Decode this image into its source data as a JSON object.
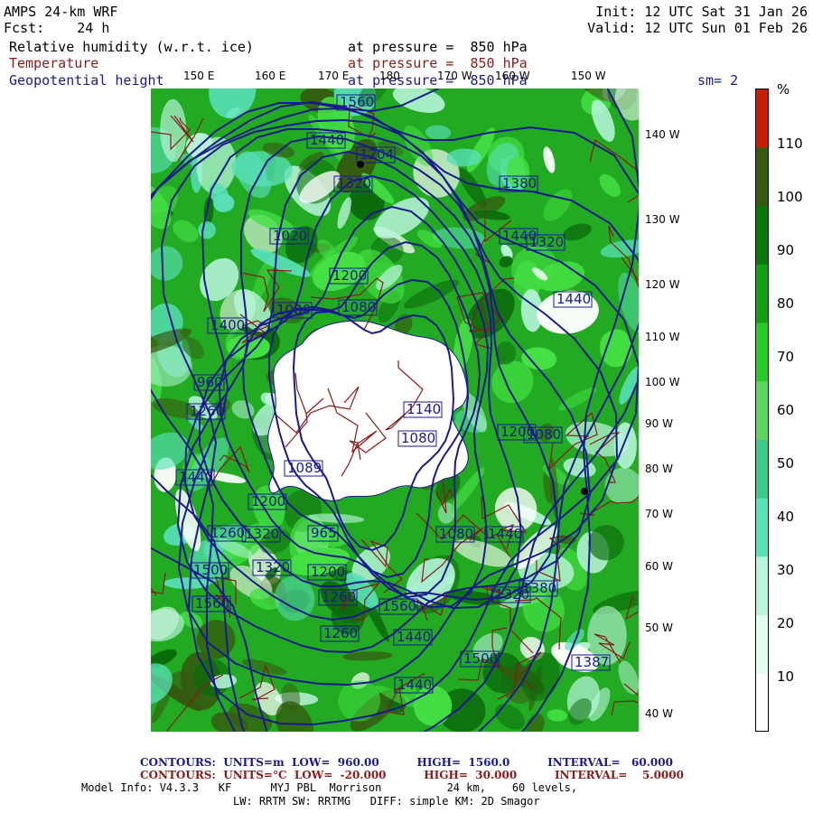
{
  "header": {
    "left_line1": "AMPS 24-km WRF",
    "left_line2": "Fcst:    24 h",
    "right_line1": "Init: 12 UTC Sat 31 Jan 26",
    "right_line2": "Valid: 12 UTC Sun 01 Feb 26",
    "field1_name": "Relative humidity (w.r.t. ice)",
    "field1_level": "at pressure =  850 hPa",
    "field2_name": "Temperature",
    "field2_level": "at pressure =  850 hPa",
    "field3_name": "Geopotential height",
    "field3_level": "at pressure =  850 hPa",
    "smoothing": "sm= 2"
  },
  "colors": {
    "rh_fill_main": "#22aa22",
    "rh_fill_light": "#44e044",
    "rh_fill_dark": "#0b6b0b",
    "rh_fill_olive": "#355a10",
    "temperature_contour": "#8b1a1a",
    "height_contour": "#1a1a8c",
    "land_ice": "#ffffff"
  },
  "top_longitude_labels": [
    "150 E",
    "160 E",
    "170 E",
    "180",
    "170 W",
    "160 W",
    "150 W"
  ],
  "right_longitude_labels": [
    "140 W",
    "130 W",
    "120 W",
    "110 W",
    "100 W",
    "90 W",
    "80 W",
    "70 W",
    "60 W",
    "50 W",
    "40 W"
  ],
  "height_contour_labels": [
    "1560",
    "1440",
    "1204",
    "1320",
    "1380",
    "1440",
    "1320",
    "1440",
    "1200",
    "1080",
    "1020",
    "1080",
    "1400",
    "960",
    "1140",
    "1260",
    "1200",
    "1080",
    "1089",
    "1080",
    "1200",
    "1260",
    "1320",
    "1440",
    "1500",
    "1560",
    "1320",
    "1200",
    "965",
    "1080",
    "1260",
    "1440",
    "1560",
    "1440",
    "1380",
    "1320",
    "1260",
    "1500",
    "1440",
    "1387"
  ],
  "colorbar": {
    "unit": "%",
    "labels": [
      "110",
      "100",
      "90",
      "80",
      "70",
      "60",
      "50",
      "40",
      "30",
      "20",
      "10"
    ],
    "colors": [
      "#ffffff",
      "#e0fff0",
      "#b8f5dc",
      "#58e0b8",
      "#3acb8b",
      "#5cd65c",
      "#26cc26",
      "#10a010",
      "#087808",
      "#355a10",
      "#c81e00"
    ]
  },
  "footer": {
    "contours1": "CONTOURS:  UNITS=m  LOW=  960.00          HIGH=  1560.0          INTERVAL=   60.000",
    "contours2": "CONTOURS:  UNITS=°C  LOW=  -20.000          HIGH=  30.000          INTERVAL=    5.0000",
    "model_info1": "Model Info: V4.3.3   KF      MYJ PBL  Morrison          24 km,    60 levels,",
    "model_info2": "LW: RRTM SW: RRTMG   DIFF: simple KM: 2D Smagor"
  }
}
